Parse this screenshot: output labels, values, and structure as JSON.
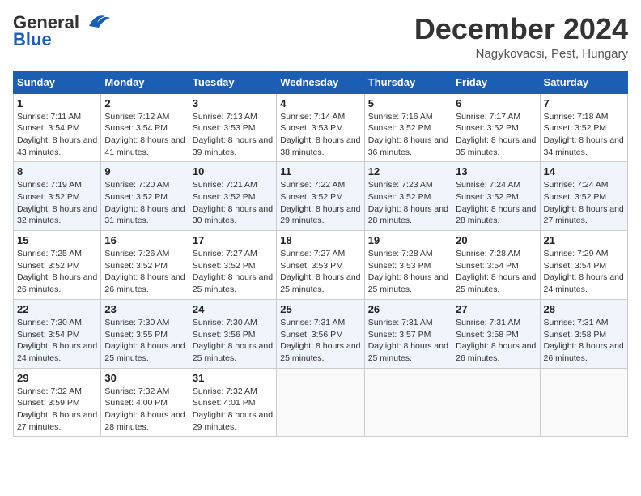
{
  "header": {
    "logo_general": "General",
    "logo_blue": "Blue",
    "month_title": "December 2024",
    "location": "Nagykovacsi, Pest, Hungary"
  },
  "weekdays": [
    "Sunday",
    "Monday",
    "Tuesday",
    "Wednesday",
    "Thursday",
    "Friday",
    "Saturday"
  ],
  "weeks": [
    [
      {
        "day": "1",
        "sunrise": "7:11 AM",
        "sunset": "3:54 PM",
        "daylight": "8 hours and 43 minutes."
      },
      {
        "day": "2",
        "sunrise": "7:12 AM",
        "sunset": "3:54 PM",
        "daylight": "8 hours and 41 minutes."
      },
      {
        "day": "3",
        "sunrise": "7:13 AM",
        "sunset": "3:53 PM",
        "daylight": "8 hours and 39 minutes."
      },
      {
        "day": "4",
        "sunrise": "7:14 AM",
        "sunset": "3:53 PM",
        "daylight": "8 hours and 38 minutes."
      },
      {
        "day": "5",
        "sunrise": "7:16 AM",
        "sunset": "3:52 PM",
        "daylight": "8 hours and 36 minutes."
      },
      {
        "day": "6",
        "sunrise": "7:17 AM",
        "sunset": "3:52 PM",
        "daylight": "8 hours and 35 minutes."
      },
      {
        "day": "7",
        "sunrise": "7:18 AM",
        "sunset": "3:52 PM",
        "daylight": "8 hours and 34 minutes."
      }
    ],
    [
      {
        "day": "8",
        "sunrise": "7:19 AM",
        "sunset": "3:52 PM",
        "daylight": "8 hours and 32 minutes."
      },
      {
        "day": "9",
        "sunrise": "7:20 AM",
        "sunset": "3:52 PM",
        "daylight": "8 hours and 31 minutes."
      },
      {
        "day": "10",
        "sunrise": "7:21 AM",
        "sunset": "3:52 PM",
        "daylight": "8 hours and 30 minutes."
      },
      {
        "day": "11",
        "sunrise": "7:22 AM",
        "sunset": "3:52 PM",
        "daylight": "8 hours and 29 minutes."
      },
      {
        "day": "12",
        "sunrise": "7:23 AM",
        "sunset": "3:52 PM",
        "daylight": "8 hours and 28 minutes."
      },
      {
        "day": "13",
        "sunrise": "7:24 AM",
        "sunset": "3:52 PM",
        "daylight": "8 hours and 28 minutes."
      },
      {
        "day": "14",
        "sunrise": "7:24 AM",
        "sunset": "3:52 PM",
        "daylight": "8 hours and 27 minutes."
      }
    ],
    [
      {
        "day": "15",
        "sunrise": "7:25 AM",
        "sunset": "3:52 PM",
        "daylight": "8 hours and 26 minutes."
      },
      {
        "day": "16",
        "sunrise": "7:26 AM",
        "sunset": "3:52 PM",
        "daylight": "8 hours and 26 minutes."
      },
      {
        "day": "17",
        "sunrise": "7:27 AM",
        "sunset": "3:52 PM",
        "daylight": "8 hours and 25 minutes."
      },
      {
        "day": "18",
        "sunrise": "7:27 AM",
        "sunset": "3:53 PM",
        "daylight": "8 hours and 25 minutes."
      },
      {
        "day": "19",
        "sunrise": "7:28 AM",
        "sunset": "3:53 PM",
        "daylight": "8 hours and 25 minutes."
      },
      {
        "day": "20",
        "sunrise": "7:28 AM",
        "sunset": "3:54 PM",
        "daylight": "8 hours and 25 minutes."
      },
      {
        "day": "21",
        "sunrise": "7:29 AM",
        "sunset": "3:54 PM",
        "daylight": "8 hours and 24 minutes."
      }
    ],
    [
      {
        "day": "22",
        "sunrise": "7:30 AM",
        "sunset": "3:54 PM",
        "daylight": "8 hours and 24 minutes."
      },
      {
        "day": "23",
        "sunrise": "7:30 AM",
        "sunset": "3:55 PM",
        "daylight": "8 hours and 25 minutes."
      },
      {
        "day": "24",
        "sunrise": "7:30 AM",
        "sunset": "3:56 PM",
        "daylight": "8 hours and 25 minutes."
      },
      {
        "day": "25",
        "sunrise": "7:31 AM",
        "sunset": "3:56 PM",
        "daylight": "8 hours and 25 minutes."
      },
      {
        "day": "26",
        "sunrise": "7:31 AM",
        "sunset": "3:57 PM",
        "daylight": "8 hours and 25 minutes."
      },
      {
        "day": "27",
        "sunrise": "7:31 AM",
        "sunset": "3:58 PM",
        "daylight": "8 hours and 26 minutes."
      },
      {
        "day": "28",
        "sunrise": "7:31 AM",
        "sunset": "3:58 PM",
        "daylight": "8 hours and 26 minutes."
      }
    ],
    [
      {
        "day": "29",
        "sunrise": "7:32 AM",
        "sunset": "3:59 PM",
        "daylight": "8 hours and 27 minutes."
      },
      {
        "day": "30",
        "sunrise": "7:32 AM",
        "sunset": "4:00 PM",
        "daylight": "8 hours and 28 minutes."
      },
      {
        "day": "31",
        "sunrise": "7:32 AM",
        "sunset": "4:01 PM",
        "daylight": "8 hours and 29 minutes."
      },
      null,
      null,
      null,
      null
    ]
  ]
}
